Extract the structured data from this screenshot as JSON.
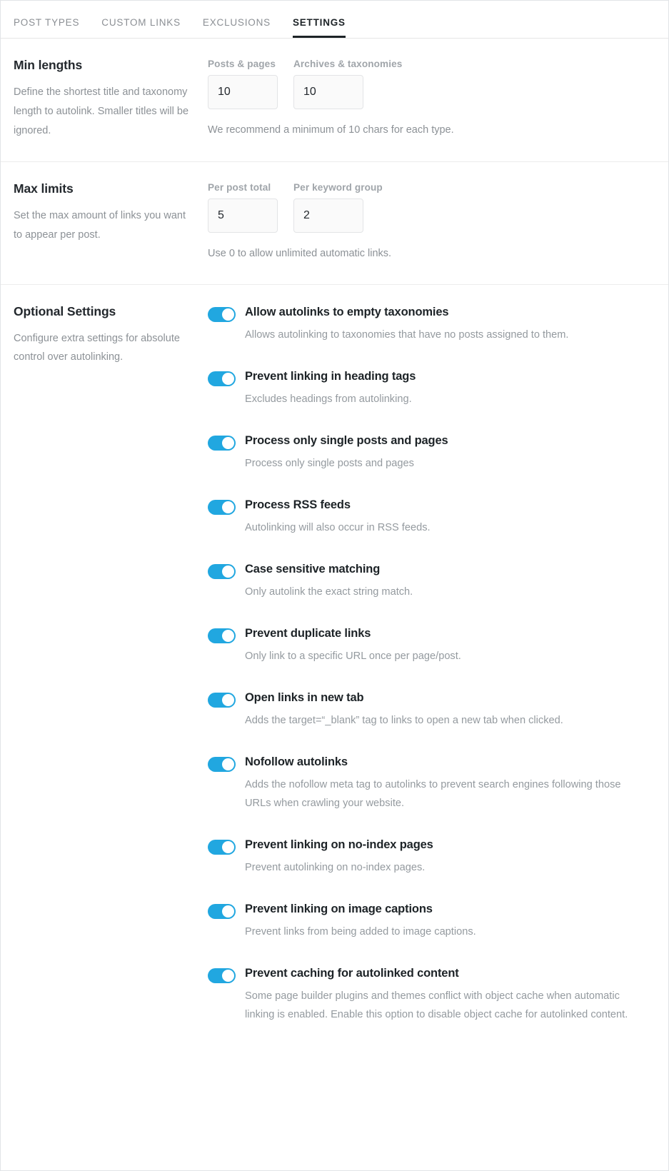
{
  "tabs": [
    {
      "label": "POST TYPES",
      "active": false
    },
    {
      "label": "CUSTOM LINKS",
      "active": false
    },
    {
      "label": "EXCLUSIONS",
      "active": false
    },
    {
      "label": "SETTINGS",
      "active": true
    }
  ],
  "colors": {
    "toggle_on": "#21a7e0",
    "tab_active": "#1d2327",
    "muted_text": "#949a9f"
  },
  "sections": {
    "min_lengths": {
      "title": "Min lengths",
      "description": "Define the shortest title and taxonomy length to autolink. Smaller titles will be ignored.",
      "fields": [
        {
          "label": "Posts & pages",
          "value": "10"
        },
        {
          "label": "Archives & taxonomies",
          "value": "10"
        }
      ],
      "helper": "We recommend a minimum of 10 chars for each type."
    },
    "max_limits": {
      "title": "Max limits",
      "description": "Set the max amount of links you want to appear per post.",
      "fields": [
        {
          "label": "Per post total",
          "value": "5"
        },
        {
          "label": "Per keyword group",
          "value": "2"
        }
      ],
      "helper": "Use 0 to allow unlimited automatic links."
    },
    "optional": {
      "title": "Optional Settings",
      "description": "Configure extra settings for absolute control over autolinking.",
      "toggles": [
        {
          "label": "Allow autolinks to empty taxonomies",
          "description": "Allows autolinking to taxonomies that have no posts assigned to them.",
          "on": true
        },
        {
          "label": "Prevent linking in heading tags",
          "description": "Excludes headings from autolinking.",
          "on": true
        },
        {
          "label": "Process only single posts and pages",
          "description": "Process only single posts and pages",
          "on": true
        },
        {
          "label": "Process RSS feeds",
          "description": "Autolinking will also occur in RSS feeds.",
          "on": true
        },
        {
          "label": "Case sensitive matching",
          "description": "Only autolink the exact string match.",
          "on": true
        },
        {
          "label": "Prevent duplicate links",
          "description": "Only link to a specific URL once per page/post.",
          "on": true
        },
        {
          "label": "Open links in new tab",
          "description": "Adds the target=“_blank” tag to links to open a new tab when clicked.",
          "on": true
        },
        {
          "label": "Nofollow autolinks",
          "description": "Adds the nofollow meta tag to autolinks to prevent search engines following those URLs when crawling your website.",
          "on": true
        },
        {
          "label": "Prevent linking on no-index pages",
          "description": "Prevent autolinking on no-index pages.",
          "on": true
        },
        {
          "label": "Prevent linking on image captions",
          "description": "Prevent links from being added to image captions.",
          "on": true
        },
        {
          "label": "Prevent caching for autolinked content",
          "description": "Some page builder plugins and themes conflict with object cache when automatic linking is enabled. Enable this option to disable object cache for autolinked content.",
          "on": true
        }
      ]
    }
  }
}
